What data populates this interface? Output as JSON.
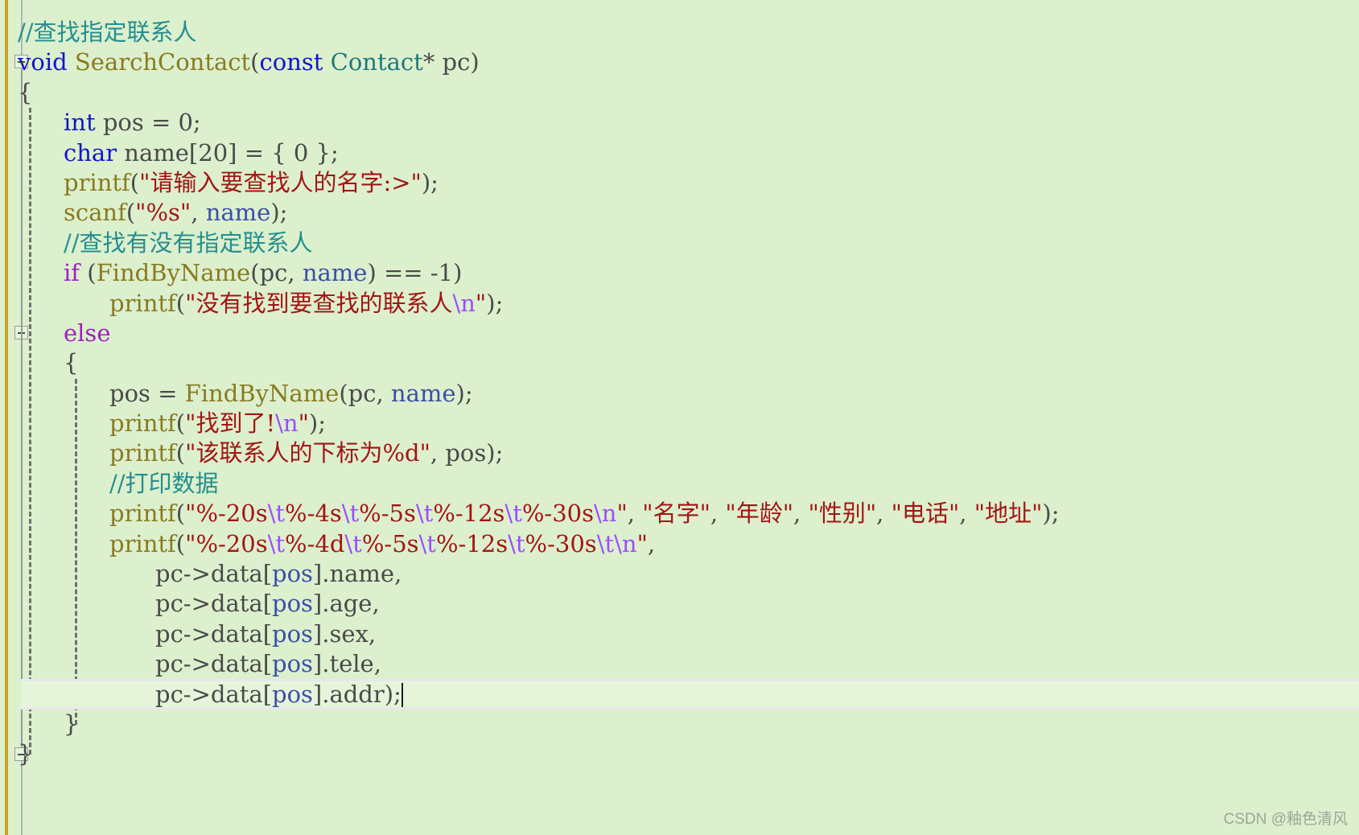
{
  "editor": {
    "background": "#dcf0cd",
    "current_line_background": "#e6f5da",
    "selection_margin_color": "#c9a227",
    "caret_visible": true
  },
  "colors": {
    "comment": "#248f8f",
    "keyword": "#1414cc",
    "control_keyword": "#a020c0",
    "function": "#8a7a20",
    "type": "#1f7a7a",
    "variable": "#3b4fa8",
    "plain": "#4a4a4a",
    "string": "#a31515",
    "escape": "#9b4dff"
  },
  "code": {
    "lines": [
      {
        "n": 1,
        "indent": 0,
        "fold": null,
        "text": "//查找指定联系人"
      },
      {
        "n": 2,
        "indent": 0,
        "fold": "open",
        "text": "void SearchContact(const Contact* pc)"
      },
      {
        "n": 3,
        "indent": 0,
        "fold": null,
        "text": "{"
      },
      {
        "n": 4,
        "indent": 1,
        "fold": null,
        "text": "int pos = 0;"
      },
      {
        "n": 5,
        "indent": 1,
        "fold": null,
        "text": "char name[20] = { 0 };"
      },
      {
        "n": 6,
        "indent": 1,
        "fold": null,
        "text": "printf(\"请输入要查找人的名字:>\");"
      },
      {
        "n": 7,
        "indent": 1,
        "fold": null,
        "text": "scanf(\"%s\", name);"
      },
      {
        "n": 8,
        "indent": 1,
        "fold": null,
        "text": "//查找有没有指定联系人"
      },
      {
        "n": 9,
        "indent": 1,
        "fold": null,
        "text": "if (FindByName(pc, name) == -1)"
      },
      {
        "n": 10,
        "indent": 2,
        "fold": null,
        "text": "printf(\"没有找到要查找的联系人\\n\");"
      },
      {
        "n": 11,
        "indent": 1,
        "fold": "open",
        "text": "else"
      },
      {
        "n": 12,
        "indent": 1,
        "fold": null,
        "text": "{"
      },
      {
        "n": 13,
        "indent": 2,
        "fold": null,
        "text": "pos = FindByName(pc, name);"
      },
      {
        "n": 14,
        "indent": 2,
        "fold": null,
        "text": "printf(\"找到了!\\n\");"
      },
      {
        "n": 15,
        "indent": 2,
        "fold": null,
        "text": "printf(\"该联系人的下标为%d\", pos);"
      },
      {
        "n": 16,
        "indent": 2,
        "fold": null,
        "text": "//打印数据"
      },
      {
        "n": 17,
        "indent": 2,
        "fold": null,
        "text": "printf(\"%-20s\\t%-4s\\t%-5s\\t%-12s\\t%-30s\\n\", \"名字\", \"年龄\", \"性别\", \"电话\", \"地址\");"
      },
      {
        "n": 18,
        "indent": 2,
        "fold": null,
        "text": "printf(\"%-20s\\t%-4d\\t%-5s\\t%-12s\\t%-30s\\t\\n\","
      },
      {
        "n": 19,
        "indent": 3,
        "fold": null,
        "text": "pc->data[pos].name,"
      },
      {
        "n": 20,
        "indent": 3,
        "fold": null,
        "text": "pc->data[pos].age,"
      },
      {
        "n": 21,
        "indent": 3,
        "fold": null,
        "text": "pc->data[pos].sex,"
      },
      {
        "n": 22,
        "indent": 3,
        "fold": null,
        "text": "pc->data[pos].tele,"
      },
      {
        "n": 23,
        "indent": 3,
        "fold": null,
        "text": "pc->data[pos].addr);",
        "current": true
      },
      {
        "n": 24,
        "indent": 1,
        "fold": null,
        "text": "}"
      },
      {
        "n": 25,
        "indent": 0,
        "fold": "open",
        "text": "}"
      }
    ],
    "tokens": {
      "l1": [
        [
          "cmt",
          "//查找指定联系人"
        ]
      ],
      "l2": [
        [
          "kw",
          "void"
        ],
        [
          "pln",
          " "
        ],
        [
          "fn",
          "SearchContact"
        ],
        [
          "pun",
          "("
        ],
        [
          "kw",
          "const"
        ],
        [
          "pln",
          " "
        ],
        [
          "typ",
          "Contact"
        ],
        [
          "pun",
          "* "
        ],
        [
          "pln",
          "pc"
        ],
        [
          "pun",
          ")"
        ]
      ],
      "l3": [
        [
          "pun",
          "{"
        ]
      ],
      "l4": [
        [
          "kw",
          "int"
        ],
        [
          "pln",
          " pos = "
        ],
        [
          "num",
          "0"
        ],
        [
          "pun",
          ";"
        ]
      ],
      "l5": [
        [
          "kw",
          "char"
        ],
        [
          "pln",
          " name["
        ],
        [
          "num",
          "20"
        ],
        [
          "pln",
          "] = { "
        ],
        [
          "num",
          "0"
        ],
        [
          "pln",
          " }"
        ],
        [
          "pun",
          ";"
        ]
      ],
      "l6": [
        [
          "fn",
          "printf"
        ],
        [
          "pun",
          "("
        ],
        [
          "str",
          "\"请输入要查找人的名字:>\""
        ],
        [
          "pun",
          ");"
        ]
      ],
      "l7": [
        [
          "fn",
          "scanf"
        ],
        [
          "pun",
          "("
        ],
        [
          "str",
          "\"%s\""
        ],
        [
          "pln",
          ", "
        ],
        [
          "var",
          "name"
        ],
        [
          "pun",
          ");"
        ]
      ],
      "l8": [
        [
          "cmt",
          "//查找有没有指定联系人"
        ]
      ],
      "l9": [
        [
          "ctl",
          "if"
        ],
        [
          "pln",
          " ("
        ],
        [
          "fn",
          "FindByName"
        ],
        [
          "pun",
          "("
        ],
        [
          "pln",
          "pc, "
        ],
        [
          "var",
          "name"
        ],
        [
          "pun",
          ") == "
        ],
        [
          "num",
          "-1"
        ],
        [
          "pun",
          ")"
        ]
      ],
      "l10": [
        [
          "fn",
          "printf"
        ],
        [
          "pun",
          "("
        ],
        [
          "str",
          "\"没有找到要查找的联系人"
        ],
        [
          "esc",
          "\\n"
        ],
        [
          "str",
          "\""
        ],
        [
          "pun",
          ");"
        ]
      ],
      "l11": [
        [
          "ctl",
          "else"
        ]
      ],
      "l12": [
        [
          "pun",
          "{"
        ]
      ],
      "l13": [
        [
          "pln",
          "pos = "
        ],
        [
          "fn",
          "FindByName"
        ],
        [
          "pun",
          "("
        ],
        [
          "pln",
          "pc, "
        ],
        [
          "var",
          "name"
        ],
        [
          "pun",
          ");"
        ]
      ],
      "l14": [
        [
          "fn",
          "printf"
        ],
        [
          "pun",
          "("
        ],
        [
          "str",
          "\"找到了!"
        ],
        [
          "esc",
          "\\n"
        ],
        [
          "str",
          "\""
        ],
        [
          "pun",
          ");"
        ]
      ],
      "l15": [
        [
          "fn",
          "printf"
        ],
        [
          "pun",
          "("
        ],
        [
          "str",
          "\"该联系人的下标为%d\""
        ],
        [
          "pln",
          ", pos"
        ],
        [
          "pun",
          ");"
        ]
      ],
      "l16": [
        [
          "cmt",
          "//打印数据"
        ]
      ],
      "l17": [
        [
          "fn",
          "printf"
        ],
        [
          "pun",
          "("
        ],
        [
          "str",
          "\"%-20s"
        ],
        [
          "esc",
          "\\t"
        ],
        [
          "str",
          "%-4s"
        ],
        [
          "esc",
          "\\t"
        ],
        [
          "str",
          "%-5s"
        ],
        [
          "esc",
          "\\t"
        ],
        [
          "str",
          "%-12s"
        ],
        [
          "esc",
          "\\t"
        ],
        [
          "str",
          "%-30s"
        ],
        [
          "esc",
          "\\n"
        ],
        [
          "str",
          "\""
        ],
        [
          "pln",
          ", "
        ],
        [
          "str",
          "\"名字\""
        ],
        [
          "pln",
          ", "
        ],
        [
          "str",
          "\"年龄\""
        ],
        [
          "pln",
          ", "
        ],
        [
          "str",
          "\"性别\""
        ],
        [
          "pln",
          ", "
        ],
        [
          "str",
          "\"电话\""
        ],
        [
          "pln",
          ", "
        ],
        [
          "str",
          "\"地址\""
        ],
        [
          "pun",
          ");"
        ]
      ],
      "l18": [
        [
          "fn",
          "printf"
        ],
        [
          "pun",
          "("
        ],
        [
          "str",
          "\"%-20s"
        ],
        [
          "esc",
          "\\t"
        ],
        [
          "str",
          "%-4d"
        ],
        [
          "esc",
          "\\t"
        ],
        [
          "str",
          "%-5s"
        ],
        [
          "esc",
          "\\t"
        ],
        [
          "str",
          "%-12s"
        ],
        [
          "esc",
          "\\t"
        ],
        [
          "str",
          "%-30s"
        ],
        [
          "esc",
          "\\t"
        ],
        [
          "esc",
          "\\n"
        ],
        [
          "str",
          "\""
        ],
        [
          "pun",
          ","
        ]
      ],
      "l19": [
        [
          "pln",
          "pc->data["
        ],
        [
          "var",
          "pos"
        ],
        [
          "pln",
          "].name"
        ],
        [
          "pun",
          ","
        ]
      ],
      "l20": [
        [
          "pln",
          "pc->data["
        ],
        [
          "var",
          "pos"
        ],
        [
          "pln",
          "].age"
        ],
        [
          "pun",
          ","
        ]
      ],
      "l21": [
        [
          "pln",
          "pc->data["
        ],
        [
          "var",
          "pos"
        ],
        [
          "pln",
          "].sex"
        ],
        [
          "pun",
          ","
        ]
      ],
      "l22": [
        [
          "pln",
          "pc->data["
        ],
        [
          "var",
          "pos"
        ],
        [
          "pln",
          "].tele"
        ],
        [
          "pun",
          ","
        ]
      ],
      "l23": [
        [
          "pln",
          "pc->data["
        ],
        [
          "var",
          "pos"
        ],
        [
          "pln",
          "].addr"
        ],
        [
          "pun",
          ");"
        ]
      ],
      "l24": [
        [
          "pun",
          "}"
        ]
      ],
      "l25": [
        [
          "pun",
          "}"
        ]
      ]
    }
  },
  "watermark": {
    "text": "CSDN @釉色清风"
  }
}
